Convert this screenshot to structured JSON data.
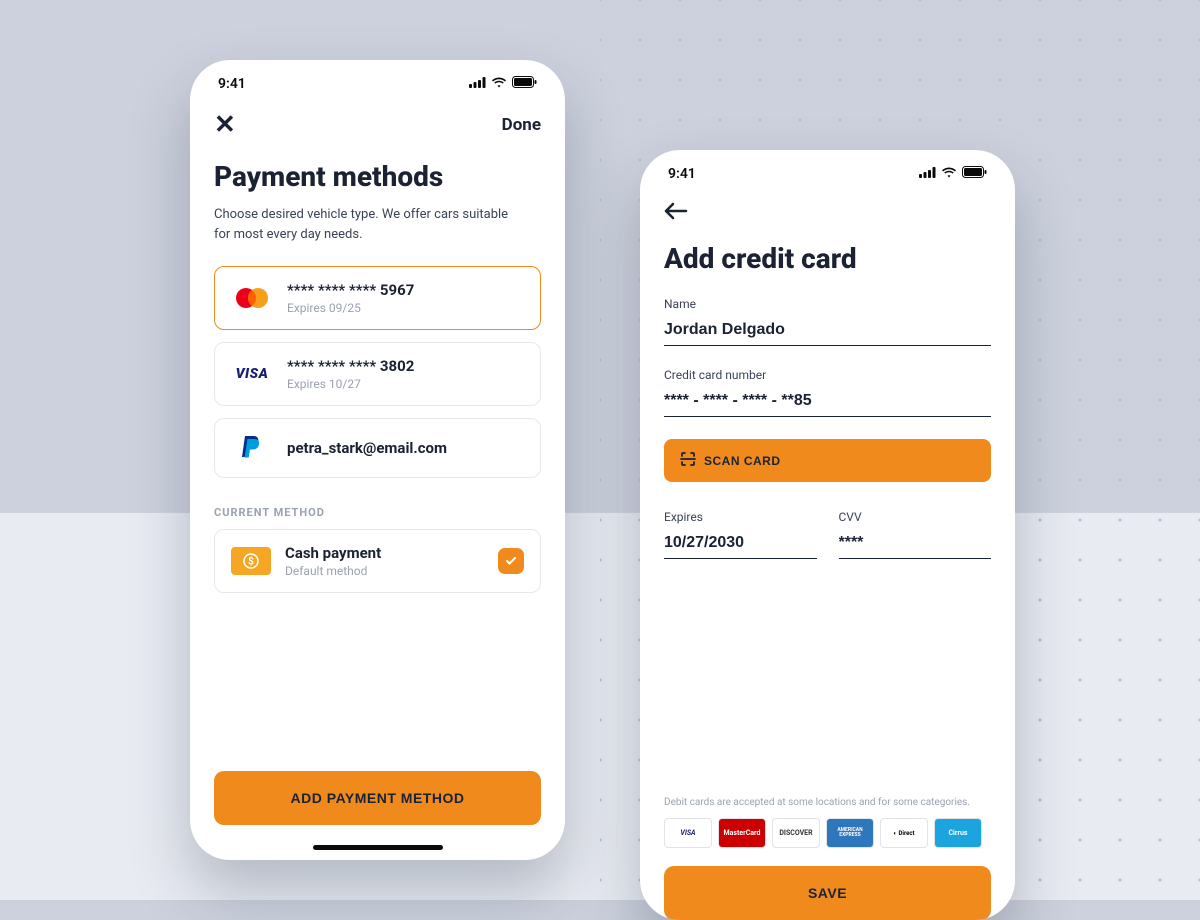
{
  "status": {
    "time": "9:41"
  },
  "screen1": {
    "nav": {
      "done_label": "Done"
    },
    "title": "Payment methods",
    "subtitle": "Choose desired vehicle type. We offer cars suitable for most every day needs.",
    "cards": [
      {
        "brand": "mastercard",
        "number": "**** **** **** 5967",
        "expires": "Expires 09/25",
        "selected": true
      },
      {
        "brand": "visa",
        "number": "**** **** **** 3802",
        "expires": "Expires 10/27",
        "selected": false
      },
      {
        "brand": "paypal",
        "number": "petra_stark@email.com",
        "expires": "",
        "selected": false
      }
    ],
    "current_label": "CURRENT METHOD",
    "cash": {
      "title": "Cash payment",
      "subtitle": "Default method"
    },
    "add_button": "ADD PAYMENT METHOD"
  },
  "screen2": {
    "title": "Add credit card",
    "fields": {
      "name_label": "Name",
      "name_value": "Jordan Delgado",
      "card_label": "Credit card number",
      "card_value": "**** - **** - **** - **85",
      "expires_label": "Expires",
      "expires_value": "10/27/2030",
      "cvv_label": "CVV",
      "cvv_value": "****"
    },
    "scan_button": "SCAN CARD",
    "accepted_note": "Debit cards are accepted at some locations and for some categories.",
    "brands": [
      "VISA",
      "MasterCard",
      "DISCOVER",
      "AMERICAN EXPRESS",
      "Direct Debit",
      "Cirrus"
    ],
    "save_button": "SAVE"
  },
  "colors": {
    "accent": "#f08a1d",
    "text": "#1a2233"
  }
}
